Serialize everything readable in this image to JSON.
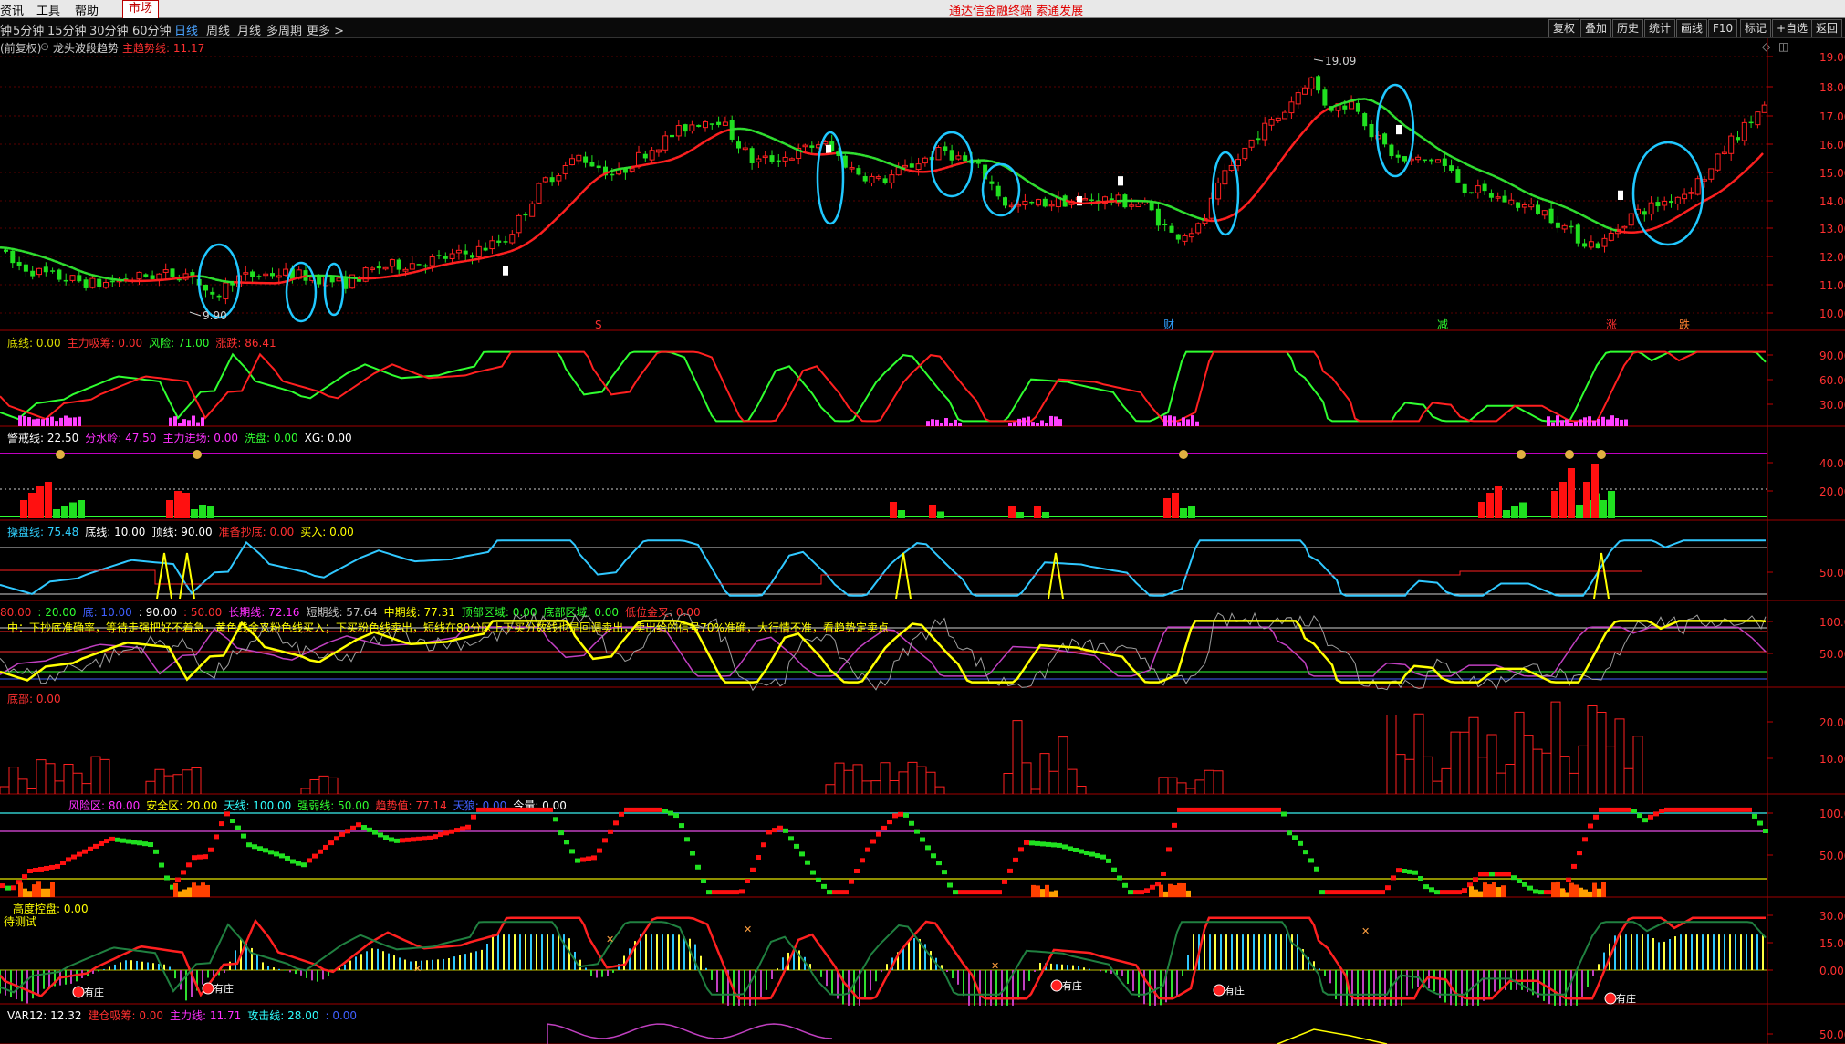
{
  "menu": {
    "items": [
      "资讯",
      "工具",
      "帮助"
    ],
    "active_tab": "市场",
    "slogan": "通达信金融终端  索通发展"
  },
  "periods": {
    "items": [
      "钟",
      "5分钟",
      "15分钟",
      "30分钟",
      "60分钟",
      "日线",
      "周线",
      "月线",
      "多周期",
      "更多 >"
    ],
    "active": "日线"
  },
  "toolbar": {
    "buttons": [
      "复权",
      "叠加",
      "历史",
      "统计",
      "画线",
      "F10",
      "标记",
      "+自选",
      "返回"
    ]
  },
  "main_title": {
    "mode": "前复权",
    "indicator": "龙头波段趋势",
    "line_label": "主趋势线: 11.17"
  },
  "price_axis": [
    "19.00",
    "18.00",
    "17.00",
    "16.00",
    "15.00",
    "14.00",
    "13.00",
    "12.00",
    "11.00",
    "10.00"
  ],
  "price_annotations": {
    "high": "19.09",
    "low": "9.90"
  },
  "event_marks": [
    "S",
    "财",
    "减",
    "涨",
    "跌"
  ],
  "panels": [
    {
      "title_parts": [
        {
          "t": "底线: 0.00",
          "c": "#dcdc00"
        },
        {
          "t": "主力吸筹: 0.00",
          "c": "#ff3030"
        },
        {
          "t": "风险: 71.00",
          "c": "#30ff30"
        },
        {
          "t": "涨跌: 86.41",
          "c": "#ff3030"
        }
      ],
      "axis": [
        "90.00",
        "60.00",
        "30.00"
      ]
    },
    {
      "title_parts": [
        {
          "t": "警戒线: 22.50",
          "c": "#ffffff"
        },
        {
          "t": "分水岭: 47.50",
          "c": "#ff30ff"
        },
        {
          "t": "主力进场: 0.00",
          "c": "#ff30ff"
        },
        {
          "t": "洗盘: 0.00",
          "c": "#30ff30"
        },
        {
          "t": "XG: 0.00",
          "c": "#ffffff"
        }
      ],
      "axis": [
        "40.00",
        "20.00"
      ]
    },
    {
      "title_parts": [
        {
          "t": "操盘线: 75.48",
          "c": "#30d0ff"
        },
        {
          "t": "底线: 10.00",
          "c": "#ffffff"
        },
        {
          "t": "顶线: 90.00",
          "c": "#ffffff"
        },
        {
          "t": "准备抄底: 0.00",
          "c": "#ff3030"
        },
        {
          "t": "买入: 0.00",
          "c": "#ffff00"
        }
      ],
      "axis": [
        "50.00"
      ]
    },
    {
      "title_parts": [
        {
          "t": "80.00",
          "c": "#ff3030"
        },
        {
          "t": ": 20.00",
          "c": "#30ff30"
        },
        {
          "t": "底: 10.00",
          "c": "#4060ff"
        },
        {
          "t": ": 90.00",
          "c": "#ffffff"
        },
        {
          "t": ": 50.00",
          "c": "#ff3030"
        },
        {
          "t": "长期线: 72.16",
          "c": "#ff30ff"
        },
        {
          "t": "短期线: 57.64",
          "c": "#c0c0c0"
        },
        {
          "t": "中期线: 77.31",
          "c": "#ffff00"
        },
        {
          "t": "顶部区域: 0.00",
          "c": "#30ff30"
        },
        {
          "t": "底部区域: 0.00",
          "c": "#30ff30"
        },
        {
          "t": "低位金叉: 0.00",
          "c": "#ff3030"
        }
      ],
      "axis": [
        "100.0",
        "50.00"
      ]
    },
    {
      "title_parts": [
        {
          "t": "底部: 0.00",
          "c": "#ff3030"
        }
      ],
      "axis": [
        "20.00",
        "10.00"
      ]
    },
    {
      "title_parts": [
        {
          "t": "风险区: 80.00",
          "c": "#ff30ff"
        },
        {
          "t": "安全区: 20.00",
          "c": "#ffff00"
        },
        {
          "t": "天线: 100.00",
          "c": "#30ffff"
        },
        {
          "t": "强弱线: 50.00",
          "c": "#30ff30"
        },
        {
          "t": "趋势值: 77.14",
          "c": "#ff3030"
        },
        {
          "t": "天狼: 0.00",
          "c": "#4060ff"
        },
        {
          "t": "今量: 0.00",
          "c": "#ffffff"
        }
      ],
      "axis": [
        "100.0",
        "50.00"
      ]
    },
    {
      "title_parts": [
        {
          "t": "高度控盘: 0.00",
          "c": "#ffff00"
        }
      ],
      "axis": [
        "30.00",
        "15.00",
        "0.00"
      ]
    },
    {
      "title_parts": [
        {
          "t": "VAR12: 12.32",
          "c": "#ffffff"
        },
        {
          "t": "建仓吸筹: 0.00",
          "c": "#ff3030"
        },
        {
          "t": "主力线: 11.71",
          "c": "#ff30ff"
        },
        {
          "t": "攻击线: 28.00",
          "c": "#30ffff"
        },
        {
          "t": ": 0.00",
          "c": "#4060ff"
        }
      ],
      "axis": [
        "50.00"
      ]
    }
  ],
  "banner_text": "中：下抄底准确率，等待走强把好不着急，黄色线金叉粉色线买入；下买粉色线卖出，短线在80分区上下买分数线也是回调卖出，卖出给的信号70%准确，大行情不准，看趋势定卖点",
  "test_label": "待测试",
  "zhuang_labels": [
    "有庄",
    "有庄",
    "有庄",
    "有庄",
    "有庄"
  ]
}
